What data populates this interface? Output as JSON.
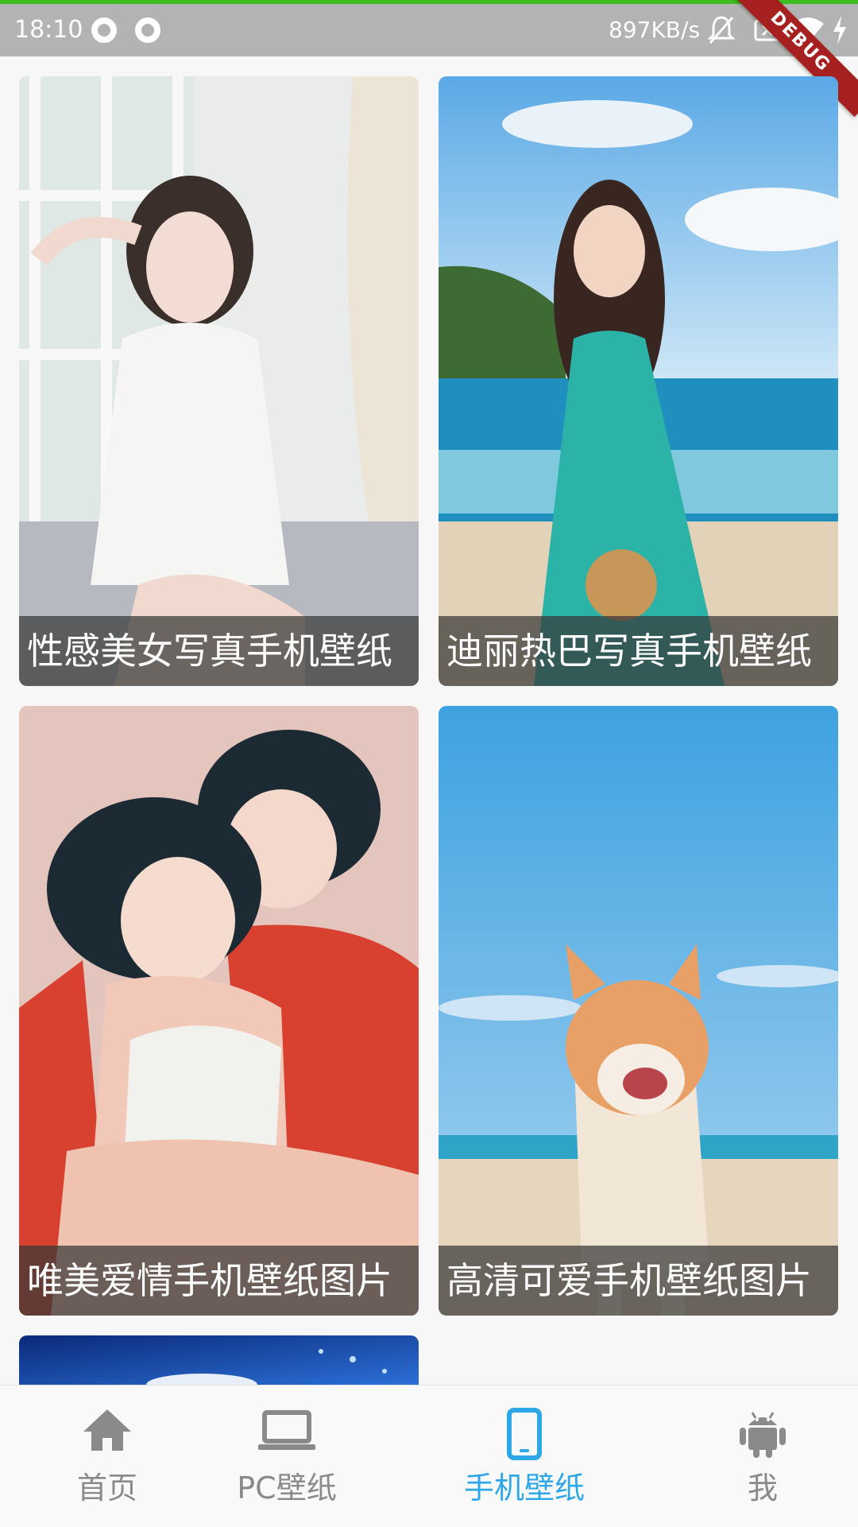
{
  "status_bar": {
    "time": "18:10",
    "speed": "897KB/s",
    "debug_banner": "DEBUG"
  },
  "wallpapers": [
    {
      "title": "性感美女写真手机壁纸"
    },
    {
      "title": "迪丽热巴写真手机壁纸"
    },
    {
      "title": "唯美爱情手机壁纸图片"
    },
    {
      "title": "高清可爱手机壁纸图片"
    }
  ],
  "bottom_nav": {
    "items": [
      {
        "label": "首页",
        "icon": "home-icon"
      },
      {
        "label": "PC壁纸",
        "icon": "laptop-icon"
      },
      {
        "label": "手机壁纸",
        "icon": "phone-icon"
      },
      {
        "label": "我",
        "icon": "android-icon"
      }
    ],
    "active_color": "#2ea7e8",
    "inactive_color": "#8a8a8a"
  }
}
